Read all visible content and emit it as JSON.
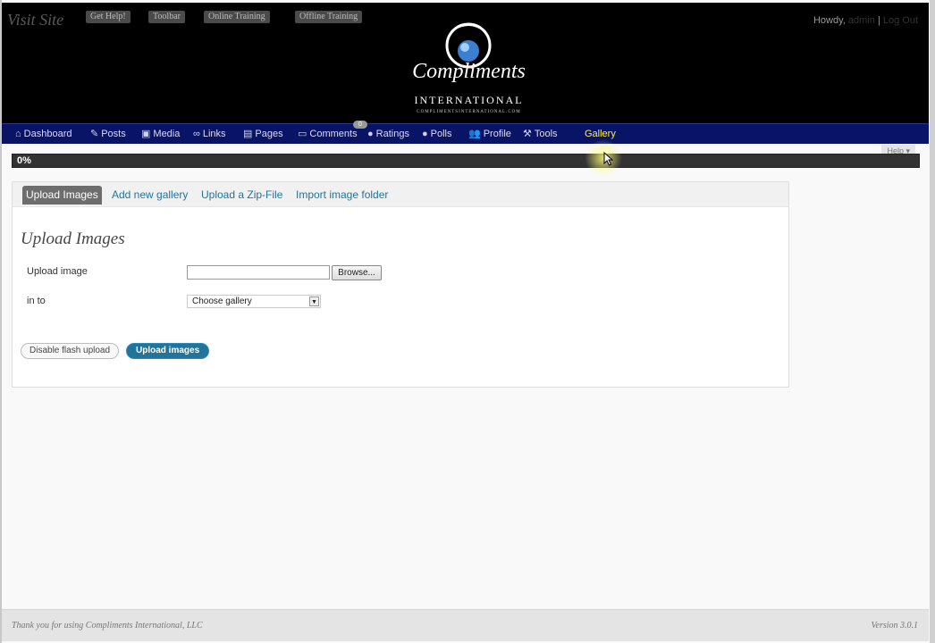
{
  "header": {
    "visit_site": "Visit Site",
    "top_buttons": [
      "Get Help!",
      "Toolbar",
      "Online Training",
      "Offline Training"
    ],
    "howdy": "Howdy,",
    "user": "admin",
    "separator": "|",
    "logout": "Log Out",
    "logo_main": "Compliments",
    "logo_sub": "INTERNATIONAL",
    "logo_url": "COMPLIMENTSINTERNATIONAL.COM"
  },
  "nav": {
    "items": [
      {
        "label": "Dashboard",
        "icon": "home-icon"
      },
      {
        "label": "Posts",
        "icon": "pin-icon"
      },
      {
        "label": "Media",
        "icon": "media-icon"
      },
      {
        "label": "Links",
        "icon": "link-icon"
      },
      {
        "label": "Pages",
        "icon": "pages-icon"
      },
      {
        "label": "Comments",
        "icon": "comment-icon"
      },
      {
        "label": "Ratings",
        "icon": "circle-icon"
      },
      {
        "label": "Polls",
        "icon": "circle-icon"
      },
      {
        "label": "Profile",
        "icon": "users-icon"
      },
      {
        "label": "Tools",
        "icon": "tools-icon"
      },
      {
        "label": "Gallery",
        "icon": ""
      }
    ],
    "comments_count": "0"
  },
  "help": "Help ▾",
  "progress": {
    "text": "0%",
    "value": 0
  },
  "tabs": [
    "Upload Images",
    "Add new gallery",
    "Upload a Zip-File",
    "Import image folder"
  ],
  "form": {
    "heading": "Upload Images",
    "upload_label": "Upload image",
    "browse": "Browse...",
    "into_label": "in to",
    "gallery_select": "Choose gallery",
    "disable_flash": "Disable flash upload",
    "upload_button": "Upload images"
  },
  "footer": {
    "left": "Thank you for using Compliments International, LLC",
    "right": "Version 3.0.1"
  },
  "colors": {
    "nav_bg": "#0a1466",
    "active_nav": "#ffef3a",
    "primary": "#21759b"
  }
}
